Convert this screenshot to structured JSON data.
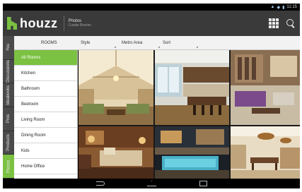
{
  "status": {
    "time": "11:15",
    "signal_icon": "signal-icon",
    "wifi_icon": "wifi-icon",
    "battery_icon": "battery-icon"
  },
  "app": {
    "brand": "houzz",
    "section": "Photos",
    "subsection": "Curate Rooms"
  },
  "sidetabs": [
    "You",
    "Discussions",
    "Ideabooks",
    "Pros",
    "Products",
    "Photos"
  ],
  "filters": {
    "rooms": "ROOMS",
    "style": "Style",
    "metro": "Metro Area",
    "sort": "Sort"
  },
  "rooms": [
    "All Rooms",
    "Kitchen",
    "Bathroom",
    "Bedroom",
    "Living Room",
    "Dining Room",
    "Kids",
    "Home Office",
    "Exterior"
  ],
  "colors": {
    "accent": "#7bc142",
    "appbar": "#3a3a3a"
  }
}
